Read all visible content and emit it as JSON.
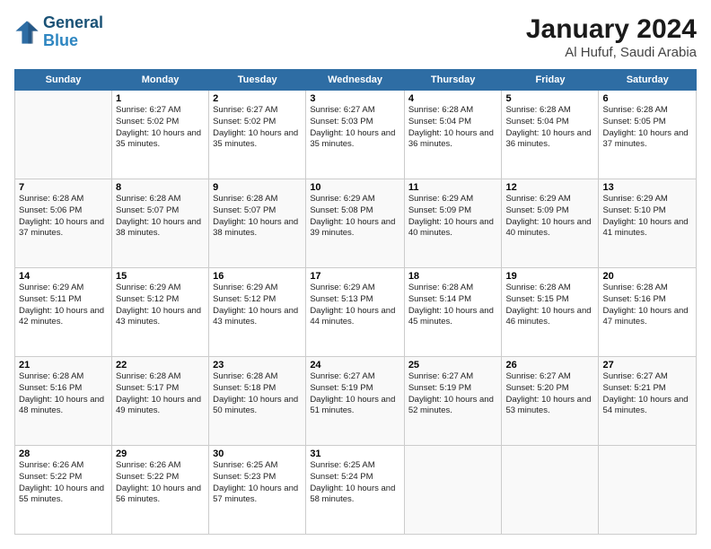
{
  "logo": {
    "line1": "General",
    "line2": "Blue"
  },
  "title": "January 2024",
  "location": "Al Hufuf, Saudi Arabia",
  "days_of_week": [
    "Sunday",
    "Monday",
    "Tuesday",
    "Wednesday",
    "Thursday",
    "Friday",
    "Saturday"
  ],
  "weeks": [
    [
      {
        "day": "",
        "sunrise": "",
        "sunset": "",
        "daylight": ""
      },
      {
        "day": "1",
        "sunrise": "Sunrise: 6:27 AM",
        "sunset": "Sunset: 5:02 PM",
        "daylight": "Daylight: 10 hours and 35 minutes."
      },
      {
        "day": "2",
        "sunrise": "Sunrise: 6:27 AM",
        "sunset": "Sunset: 5:02 PM",
        "daylight": "Daylight: 10 hours and 35 minutes."
      },
      {
        "day": "3",
        "sunrise": "Sunrise: 6:27 AM",
        "sunset": "Sunset: 5:03 PM",
        "daylight": "Daylight: 10 hours and 35 minutes."
      },
      {
        "day": "4",
        "sunrise": "Sunrise: 6:28 AM",
        "sunset": "Sunset: 5:04 PM",
        "daylight": "Daylight: 10 hours and 36 minutes."
      },
      {
        "day": "5",
        "sunrise": "Sunrise: 6:28 AM",
        "sunset": "Sunset: 5:04 PM",
        "daylight": "Daylight: 10 hours and 36 minutes."
      },
      {
        "day": "6",
        "sunrise": "Sunrise: 6:28 AM",
        "sunset": "Sunset: 5:05 PM",
        "daylight": "Daylight: 10 hours and 37 minutes."
      }
    ],
    [
      {
        "day": "7",
        "sunrise": "Sunrise: 6:28 AM",
        "sunset": "Sunset: 5:06 PM",
        "daylight": "Daylight: 10 hours and 37 minutes."
      },
      {
        "day": "8",
        "sunrise": "Sunrise: 6:28 AM",
        "sunset": "Sunset: 5:07 PM",
        "daylight": "Daylight: 10 hours and 38 minutes."
      },
      {
        "day": "9",
        "sunrise": "Sunrise: 6:28 AM",
        "sunset": "Sunset: 5:07 PM",
        "daylight": "Daylight: 10 hours and 38 minutes."
      },
      {
        "day": "10",
        "sunrise": "Sunrise: 6:29 AM",
        "sunset": "Sunset: 5:08 PM",
        "daylight": "Daylight: 10 hours and 39 minutes."
      },
      {
        "day": "11",
        "sunrise": "Sunrise: 6:29 AM",
        "sunset": "Sunset: 5:09 PM",
        "daylight": "Daylight: 10 hours and 40 minutes."
      },
      {
        "day": "12",
        "sunrise": "Sunrise: 6:29 AM",
        "sunset": "Sunset: 5:09 PM",
        "daylight": "Daylight: 10 hours and 40 minutes."
      },
      {
        "day": "13",
        "sunrise": "Sunrise: 6:29 AM",
        "sunset": "Sunset: 5:10 PM",
        "daylight": "Daylight: 10 hours and 41 minutes."
      }
    ],
    [
      {
        "day": "14",
        "sunrise": "Sunrise: 6:29 AM",
        "sunset": "Sunset: 5:11 PM",
        "daylight": "Daylight: 10 hours and 42 minutes."
      },
      {
        "day": "15",
        "sunrise": "Sunrise: 6:29 AM",
        "sunset": "Sunset: 5:12 PM",
        "daylight": "Daylight: 10 hours and 43 minutes."
      },
      {
        "day": "16",
        "sunrise": "Sunrise: 6:29 AM",
        "sunset": "Sunset: 5:12 PM",
        "daylight": "Daylight: 10 hours and 43 minutes."
      },
      {
        "day": "17",
        "sunrise": "Sunrise: 6:29 AM",
        "sunset": "Sunset: 5:13 PM",
        "daylight": "Daylight: 10 hours and 44 minutes."
      },
      {
        "day": "18",
        "sunrise": "Sunrise: 6:28 AM",
        "sunset": "Sunset: 5:14 PM",
        "daylight": "Daylight: 10 hours and 45 minutes."
      },
      {
        "day": "19",
        "sunrise": "Sunrise: 6:28 AM",
        "sunset": "Sunset: 5:15 PM",
        "daylight": "Daylight: 10 hours and 46 minutes."
      },
      {
        "day": "20",
        "sunrise": "Sunrise: 6:28 AM",
        "sunset": "Sunset: 5:16 PM",
        "daylight": "Daylight: 10 hours and 47 minutes."
      }
    ],
    [
      {
        "day": "21",
        "sunrise": "Sunrise: 6:28 AM",
        "sunset": "Sunset: 5:16 PM",
        "daylight": "Daylight: 10 hours and 48 minutes."
      },
      {
        "day": "22",
        "sunrise": "Sunrise: 6:28 AM",
        "sunset": "Sunset: 5:17 PM",
        "daylight": "Daylight: 10 hours and 49 minutes."
      },
      {
        "day": "23",
        "sunrise": "Sunrise: 6:28 AM",
        "sunset": "Sunset: 5:18 PM",
        "daylight": "Daylight: 10 hours and 50 minutes."
      },
      {
        "day": "24",
        "sunrise": "Sunrise: 6:27 AM",
        "sunset": "Sunset: 5:19 PM",
        "daylight": "Daylight: 10 hours and 51 minutes."
      },
      {
        "day": "25",
        "sunrise": "Sunrise: 6:27 AM",
        "sunset": "Sunset: 5:19 PM",
        "daylight": "Daylight: 10 hours and 52 minutes."
      },
      {
        "day": "26",
        "sunrise": "Sunrise: 6:27 AM",
        "sunset": "Sunset: 5:20 PM",
        "daylight": "Daylight: 10 hours and 53 minutes."
      },
      {
        "day": "27",
        "sunrise": "Sunrise: 6:27 AM",
        "sunset": "Sunset: 5:21 PM",
        "daylight": "Daylight: 10 hours and 54 minutes."
      }
    ],
    [
      {
        "day": "28",
        "sunrise": "Sunrise: 6:26 AM",
        "sunset": "Sunset: 5:22 PM",
        "daylight": "Daylight: 10 hours and 55 minutes."
      },
      {
        "day": "29",
        "sunrise": "Sunrise: 6:26 AM",
        "sunset": "Sunset: 5:22 PM",
        "daylight": "Daylight: 10 hours and 56 minutes."
      },
      {
        "day": "30",
        "sunrise": "Sunrise: 6:25 AM",
        "sunset": "Sunset: 5:23 PM",
        "daylight": "Daylight: 10 hours and 57 minutes."
      },
      {
        "day": "31",
        "sunrise": "Sunrise: 6:25 AM",
        "sunset": "Sunset: 5:24 PM",
        "daylight": "Daylight: 10 hours and 58 minutes."
      },
      {
        "day": "",
        "sunrise": "",
        "sunset": "",
        "daylight": ""
      },
      {
        "day": "",
        "sunrise": "",
        "sunset": "",
        "daylight": ""
      },
      {
        "day": "",
        "sunrise": "",
        "sunset": "",
        "daylight": ""
      }
    ]
  ],
  "colors": {
    "header_bg": "#2e6da4",
    "header_text": "#ffffff",
    "border": "#bbbbbb",
    "odd_row": "#ffffff",
    "even_row": "#f5f5f5"
  }
}
